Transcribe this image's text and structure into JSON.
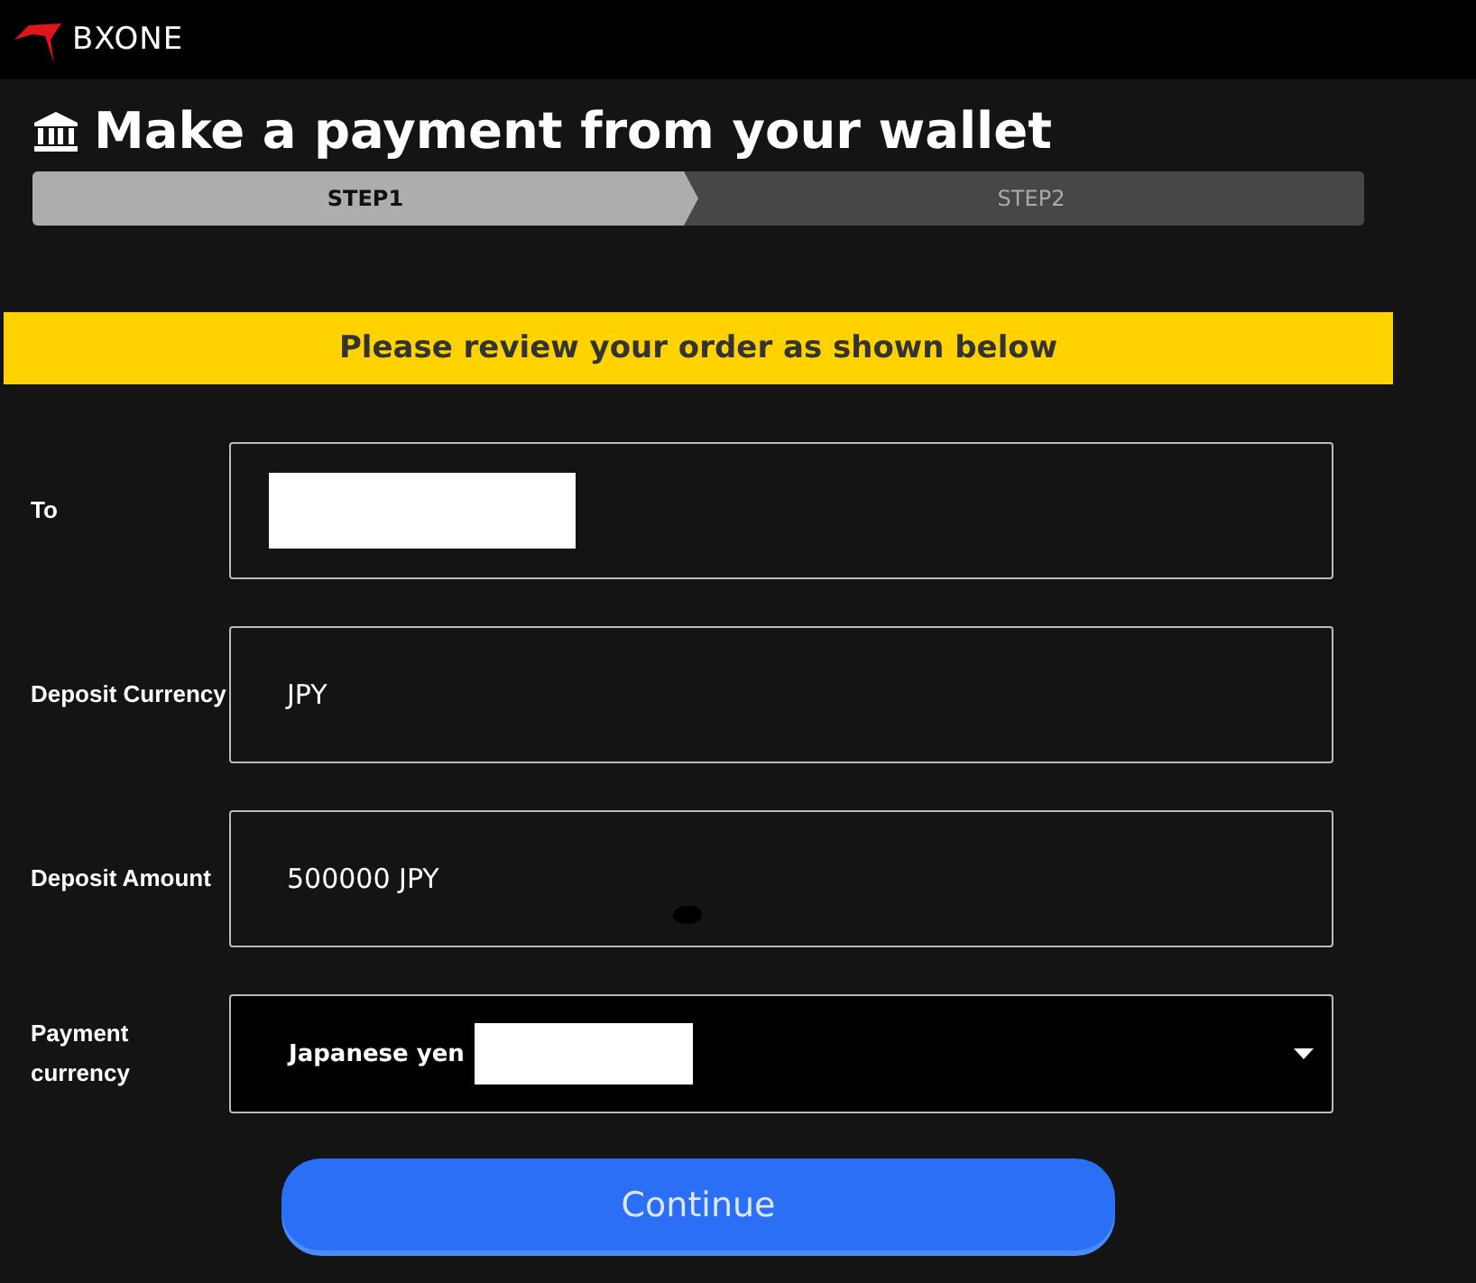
{
  "header": {
    "logo": "BXONE"
  },
  "title": "Make a payment from your wallet",
  "steps": [
    {
      "label": "STEP1",
      "selected": true
    },
    {
      "label": "STEP2",
      "selected": false
    }
  ],
  "banner": "Please review your order as shown below",
  "fields": [
    {
      "label": "To",
      "kind": "text",
      "redacted": true
    },
    {
      "label": "Deposit Currency",
      "kind": "text",
      "value": "JPY"
    },
    {
      "label": "Deposit Amount",
      "kind": "text",
      "value": "500000 JPY",
      "smudge": true
    },
    {
      "label": "Payment currency",
      "kind": "select",
      "value": "Japanese yen",
      "redacted": true
    }
  ],
  "buttons": [
    {
      "label": "Continue"
    }
  ]
}
